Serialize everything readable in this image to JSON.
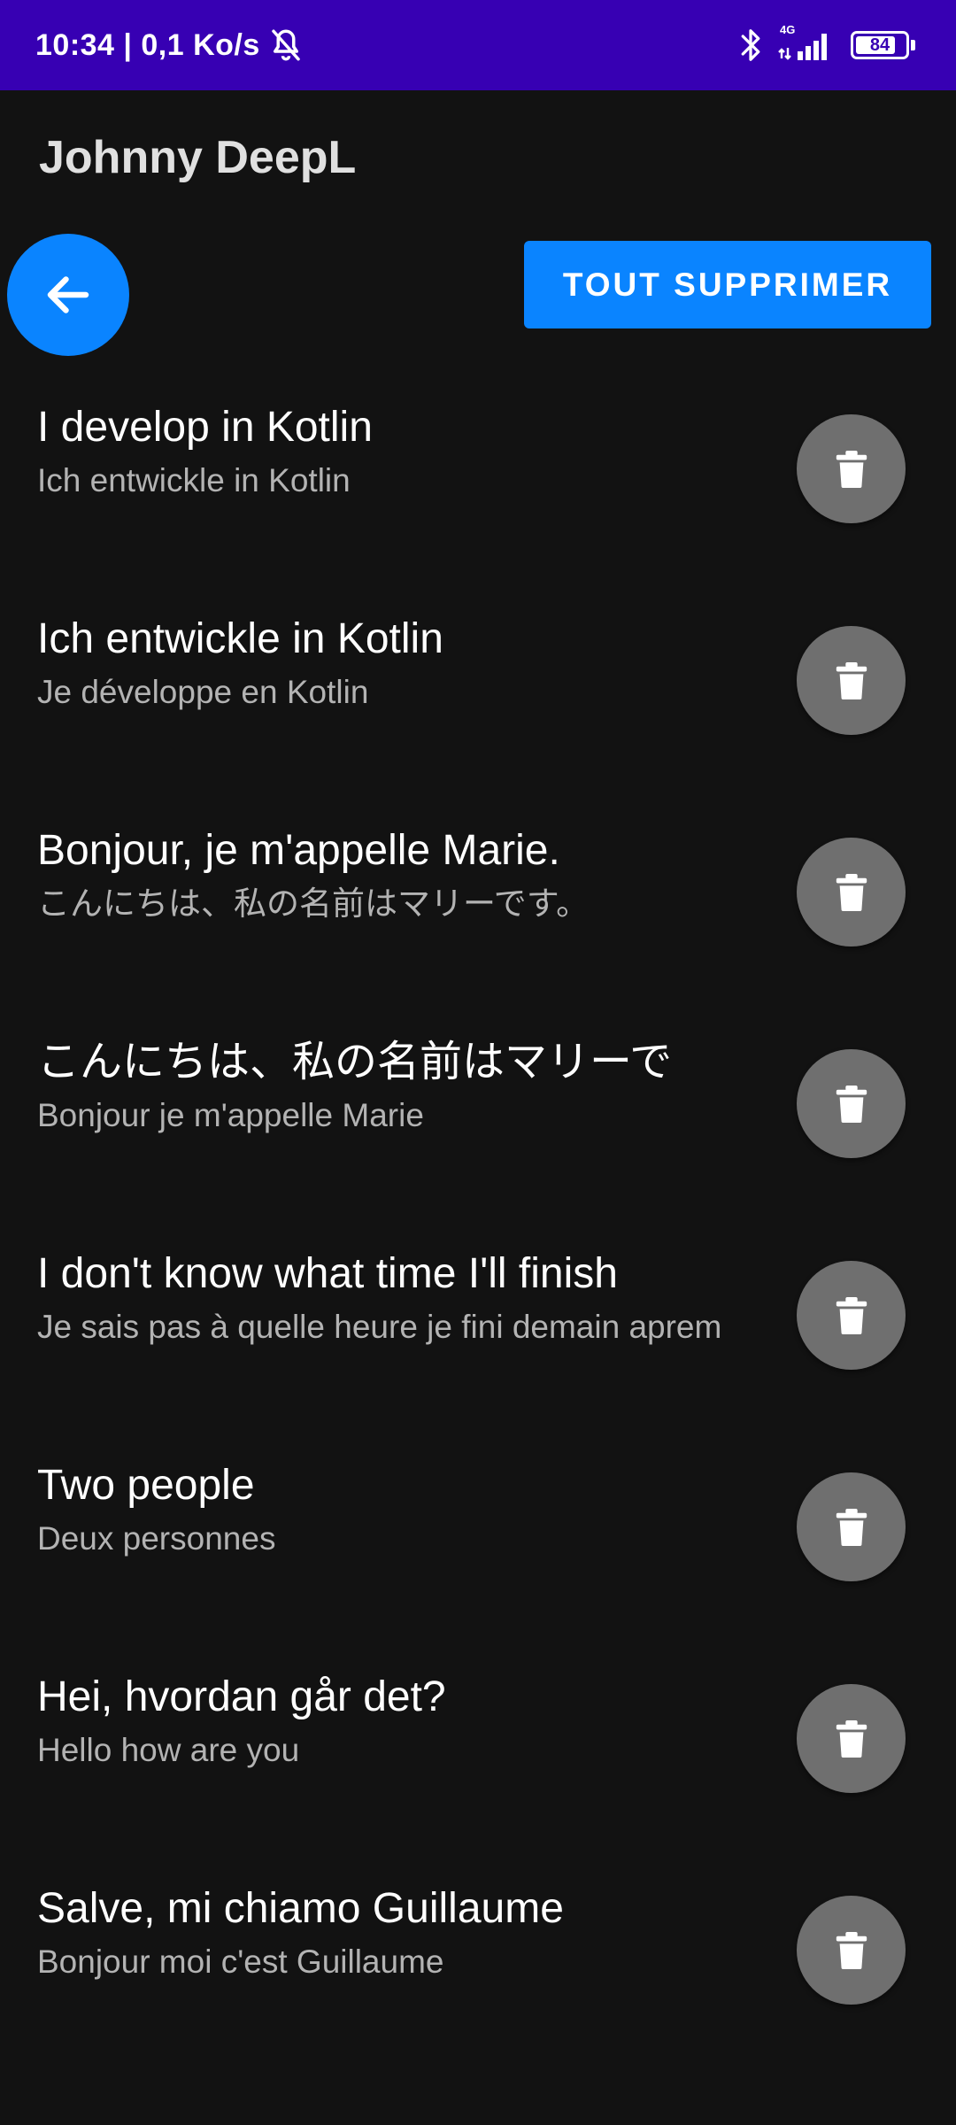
{
  "status_bar": {
    "time_speed": "10:34 | 0,1 Ko/s",
    "network": "4G",
    "battery": "84",
    "battery_level": 0.84,
    "icons": [
      "bell-off-icon",
      "bluetooth-icon",
      "signal-icon",
      "battery-icon"
    ]
  },
  "app": {
    "title": "Johnny DeepL"
  },
  "toolbar": {
    "back_icon": "arrow-left-icon",
    "delete_all_label": "TOUT SUPPRIMER"
  },
  "history": [
    {
      "source": "I develop in Kotlin",
      "translation": "Ich entwickle in Kotlin"
    },
    {
      "source": "Ich entwickle in Kotlin",
      "translation": "Je développe en Kotlin"
    },
    {
      "source": "Bonjour, je m'appelle Marie.",
      "translation": "こんにちは、私の名前はマリーです。"
    },
    {
      "source": "こんにちは、私の名前はマリーで",
      "translation": "Bonjour je m'appelle Marie"
    },
    {
      "source": "I don't know what time I'll finish",
      "translation": "Je sais pas à quelle heure je fini demain aprem"
    },
    {
      "source": "Two people",
      "translation": "Deux personnes"
    },
    {
      "source": "Hei, hvordan går det?",
      "translation": "Hello how are you"
    },
    {
      "source": "Salve, mi chiamo Guillaume",
      "translation": "Bonjour moi c'est Guillaume"
    }
  ],
  "colors": {
    "status_bar": "#3700b3",
    "background": "#121212",
    "accent": "#0a84ff",
    "delete_button": "#6f6f6f"
  }
}
